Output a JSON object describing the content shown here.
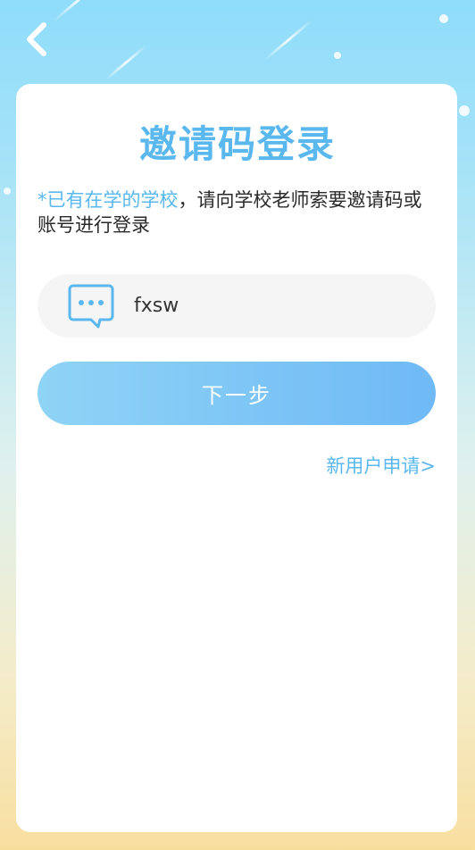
{
  "header": {
    "back_icon": "chevron-left-icon"
  },
  "title": "邀请码登录",
  "hint": {
    "highlight": "*已有在学的学校",
    "rest": "，请向学校老师索要邀请码或账号进行登录"
  },
  "invite_input": {
    "icon": "message-bubble-icon",
    "value": "fxsw"
  },
  "next_button": {
    "label": "下一步"
  },
  "new_user_link": {
    "label": "新用户申请>"
  },
  "colors": {
    "accent": "#5ab8ee",
    "button_gradient_start": "#8fd4f6",
    "button_gradient_end": "#6fb9f6"
  }
}
